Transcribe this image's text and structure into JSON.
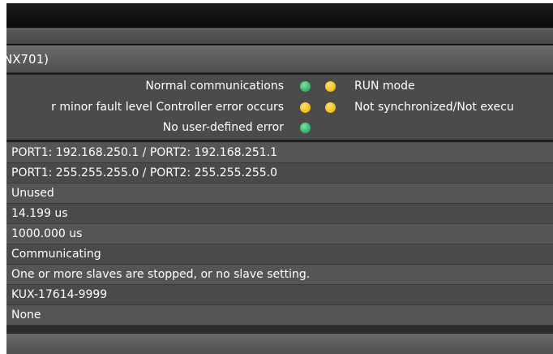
{
  "title": "NX701)",
  "status": [
    {
      "label": "Normal communications",
      "left_color": "green",
      "right_color": "yellow",
      "right_text": "RUN mode"
    },
    {
      "label": "r minor fault level Controller error occurs",
      "left_color": "yellow",
      "right_color": "yellow",
      "right_text": "Not synchronized/Not execu"
    },
    {
      "label": "No user-defined error",
      "left_color": "green",
      "right_color": "",
      "right_text": ""
    }
  ],
  "rows": [
    "PORT1: 192.168.250.1 / PORT2: 192.168.251.1",
    "PORT1: 255.255.255.0 / PORT2: 255.255.255.0",
    "Unused",
    "14.199 us",
    "1000.000 us",
    "Communicating",
    "One or more slaves are stopped, or no slave setting.",
    "KUX-17614-9999",
    "None"
  ]
}
